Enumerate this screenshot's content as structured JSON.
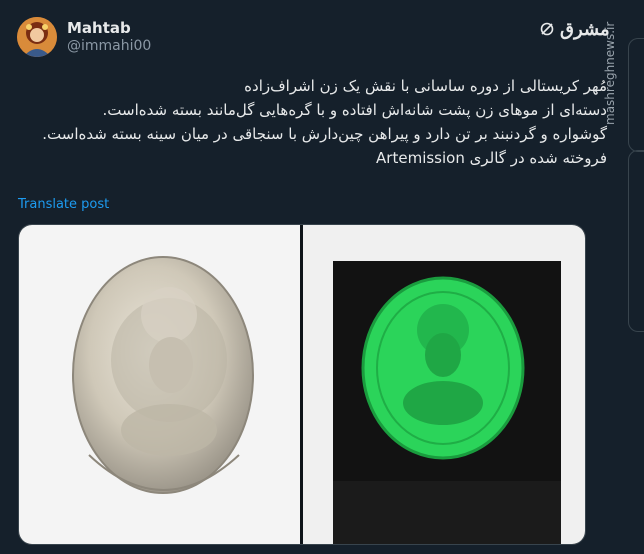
{
  "author": {
    "name": "Mahtab",
    "handle": "@immahi00"
  },
  "brand": {
    "text": "مشرق"
  },
  "post": {
    "text": "مُهر کریستالی از دوره ساسانی با نقش یک زن اشراف‌زاده\nدسته‌ای از موهای زن پشت شانه‌اش افتاده و با گره‌هایی گل‌مانند بسته شده‌است.\nگوشواره و گردنبند بر تن دارد و پیراهن چین‌دارش با سنجاقی در میان سینه بسته شده‌است.\nفروخته شده در گالری Artemission",
    "translate_label": "Translate post"
  },
  "watermark": "mashreghnews.ir",
  "colors": {
    "background": "#15202b",
    "link": "#1d9bf0",
    "seal_green": "#2bd45a"
  }
}
